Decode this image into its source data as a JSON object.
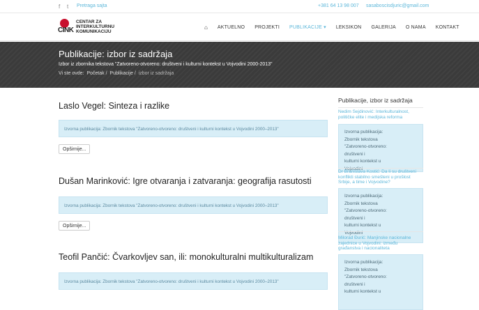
{
  "topbar": {
    "facebook_icon": "f",
    "twitter_icon": "t",
    "search_label": "Pretraga sajta",
    "phone": "+381 64 13 98 007",
    "email": "sasaboscisdjuric@gmail.com"
  },
  "logo": {
    "short": "CINK",
    "name": "CENTAR ZA INTERKULTURNU KOMUNIKACIJU"
  },
  "nav": {
    "home_icon": "⌂",
    "items": [
      "AKTUELNO",
      "PROJEKTI",
      "PUBLIKACIJE ▾",
      "LEKSIKON",
      "GALERIJA",
      "O NAMA",
      "KONTAKT"
    ]
  },
  "banner": {
    "title": "Publikacije: izbor iz sadržaja",
    "subtitle": "Izbor iz zbornika tekstova \"Zatvoreno-otvoreno: društveni i kulturni kontekst u Vojvodini 2000-2013\"",
    "crumb_prefix": "Vi ste ovde:",
    "crumbs": [
      "Početak",
      "Publikacije",
      "izbor iz sadržaja"
    ]
  },
  "posts": [
    {
      "title": "Laslo Vegel: Sinteza i razlike",
      "source": "Izvorna publikacija: Zbornik tekstova \"Zatvoreno-otvoreno: društveni i kulturni kontekst u Vojvodini 2000–2013\"",
      "more": "Opširnije..."
    },
    {
      "title": "Dušan Marinković: Igre otvaranja i zatvaranja: geografija rasutosti",
      "source": "Izvorna publikacija: Zbornik tekstova \"Zatvoreno-otvoreno: društveni i kulturni kontekst u Vojvodini 2000–2013\"",
      "more": "Opširnije..."
    },
    {
      "title": "Teofil Pančić: Čvarkovljev san, ili: monokulturalni multikulturalizam",
      "source": "Izvorna publikacija: Zbornik tekstova \"Zatvoreno-otvoreno: društveni i kulturni kontekst u Vojvodini 2000–2013\""
    }
  ],
  "sidebar": {
    "heading": "Publikacije, izbor iz sadržaja",
    "items": [
      {
        "title_lines": [
          "Nedim Sejdinović: Interkulturalnost,",
          "političke elite i medijska reforma"
        ],
        "box_lines": [
          "Izvorna publikacija:",
          "Zbornik tekstova",
          "\"Zatvoreno-otvoreno:",
          "društveni i",
          "kulturni kontekst u",
          "Vojvodini",
          "2000–2013\""
        ]
      },
      {
        "title_lines": [
          "Dr Branislava Kostić: Da li su društveni",
          "konflikti stabilno smešteni u prošlost",
          "Srbije, a time i Vojvodine?"
        ],
        "box_lines": [
          "Izvorna publikacija:",
          "Zbornik tekstova",
          "\"Zatvoreno-otvoreno:",
          "društveni i",
          "kulturni kontekst u",
          "Vojvodini",
          "2000–2013\""
        ]
      },
      {
        "title_lines": [
          "Milorad Đurić: Manjinske nacionalne",
          "zajednice u Vojvodini: između",
          "građanstva i nacionaliteta"
        ],
        "box_lines": [
          "Izvorna publikacija:",
          "Zbornik tekstova",
          "\"Zatvoreno-otvoreno:",
          "društveni i",
          "kulturni kontekst u"
        ]
      }
    ]
  }
}
